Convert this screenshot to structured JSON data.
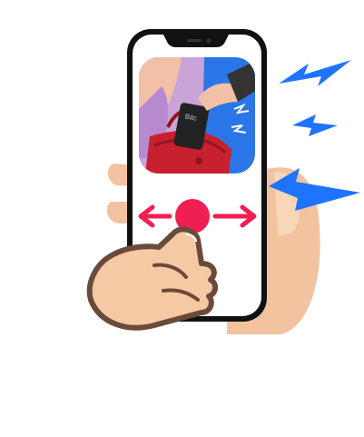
{
  "scene": {
    "phone_label": "",
    "app_icon_caption": "",
    "wallet_text": "Bitc",
    "instruction": "",
    "gesture": "swipe-left-right",
    "icons": {
      "app_icon": "pickpocket-theft-icon",
      "bolt": "lightning-bolt-icon",
      "left_arrow": "arrow-left-icon",
      "right_arrow": "arrow-right-icon",
      "finger": "pointing-finger-icon",
      "hand": "hand-holding-phone-icon",
      "slider": "slider-knob-icon"
    }
  },
  "colors": {
    "accent": "#ef1f54",
    "bolt": "#1f74ff",
    "phone_frame": "#111111",
    "skin": "#f6c9a5",
    "purse": "#c8202e",
    "icon_bg": "#2b76e6"
  }
}
